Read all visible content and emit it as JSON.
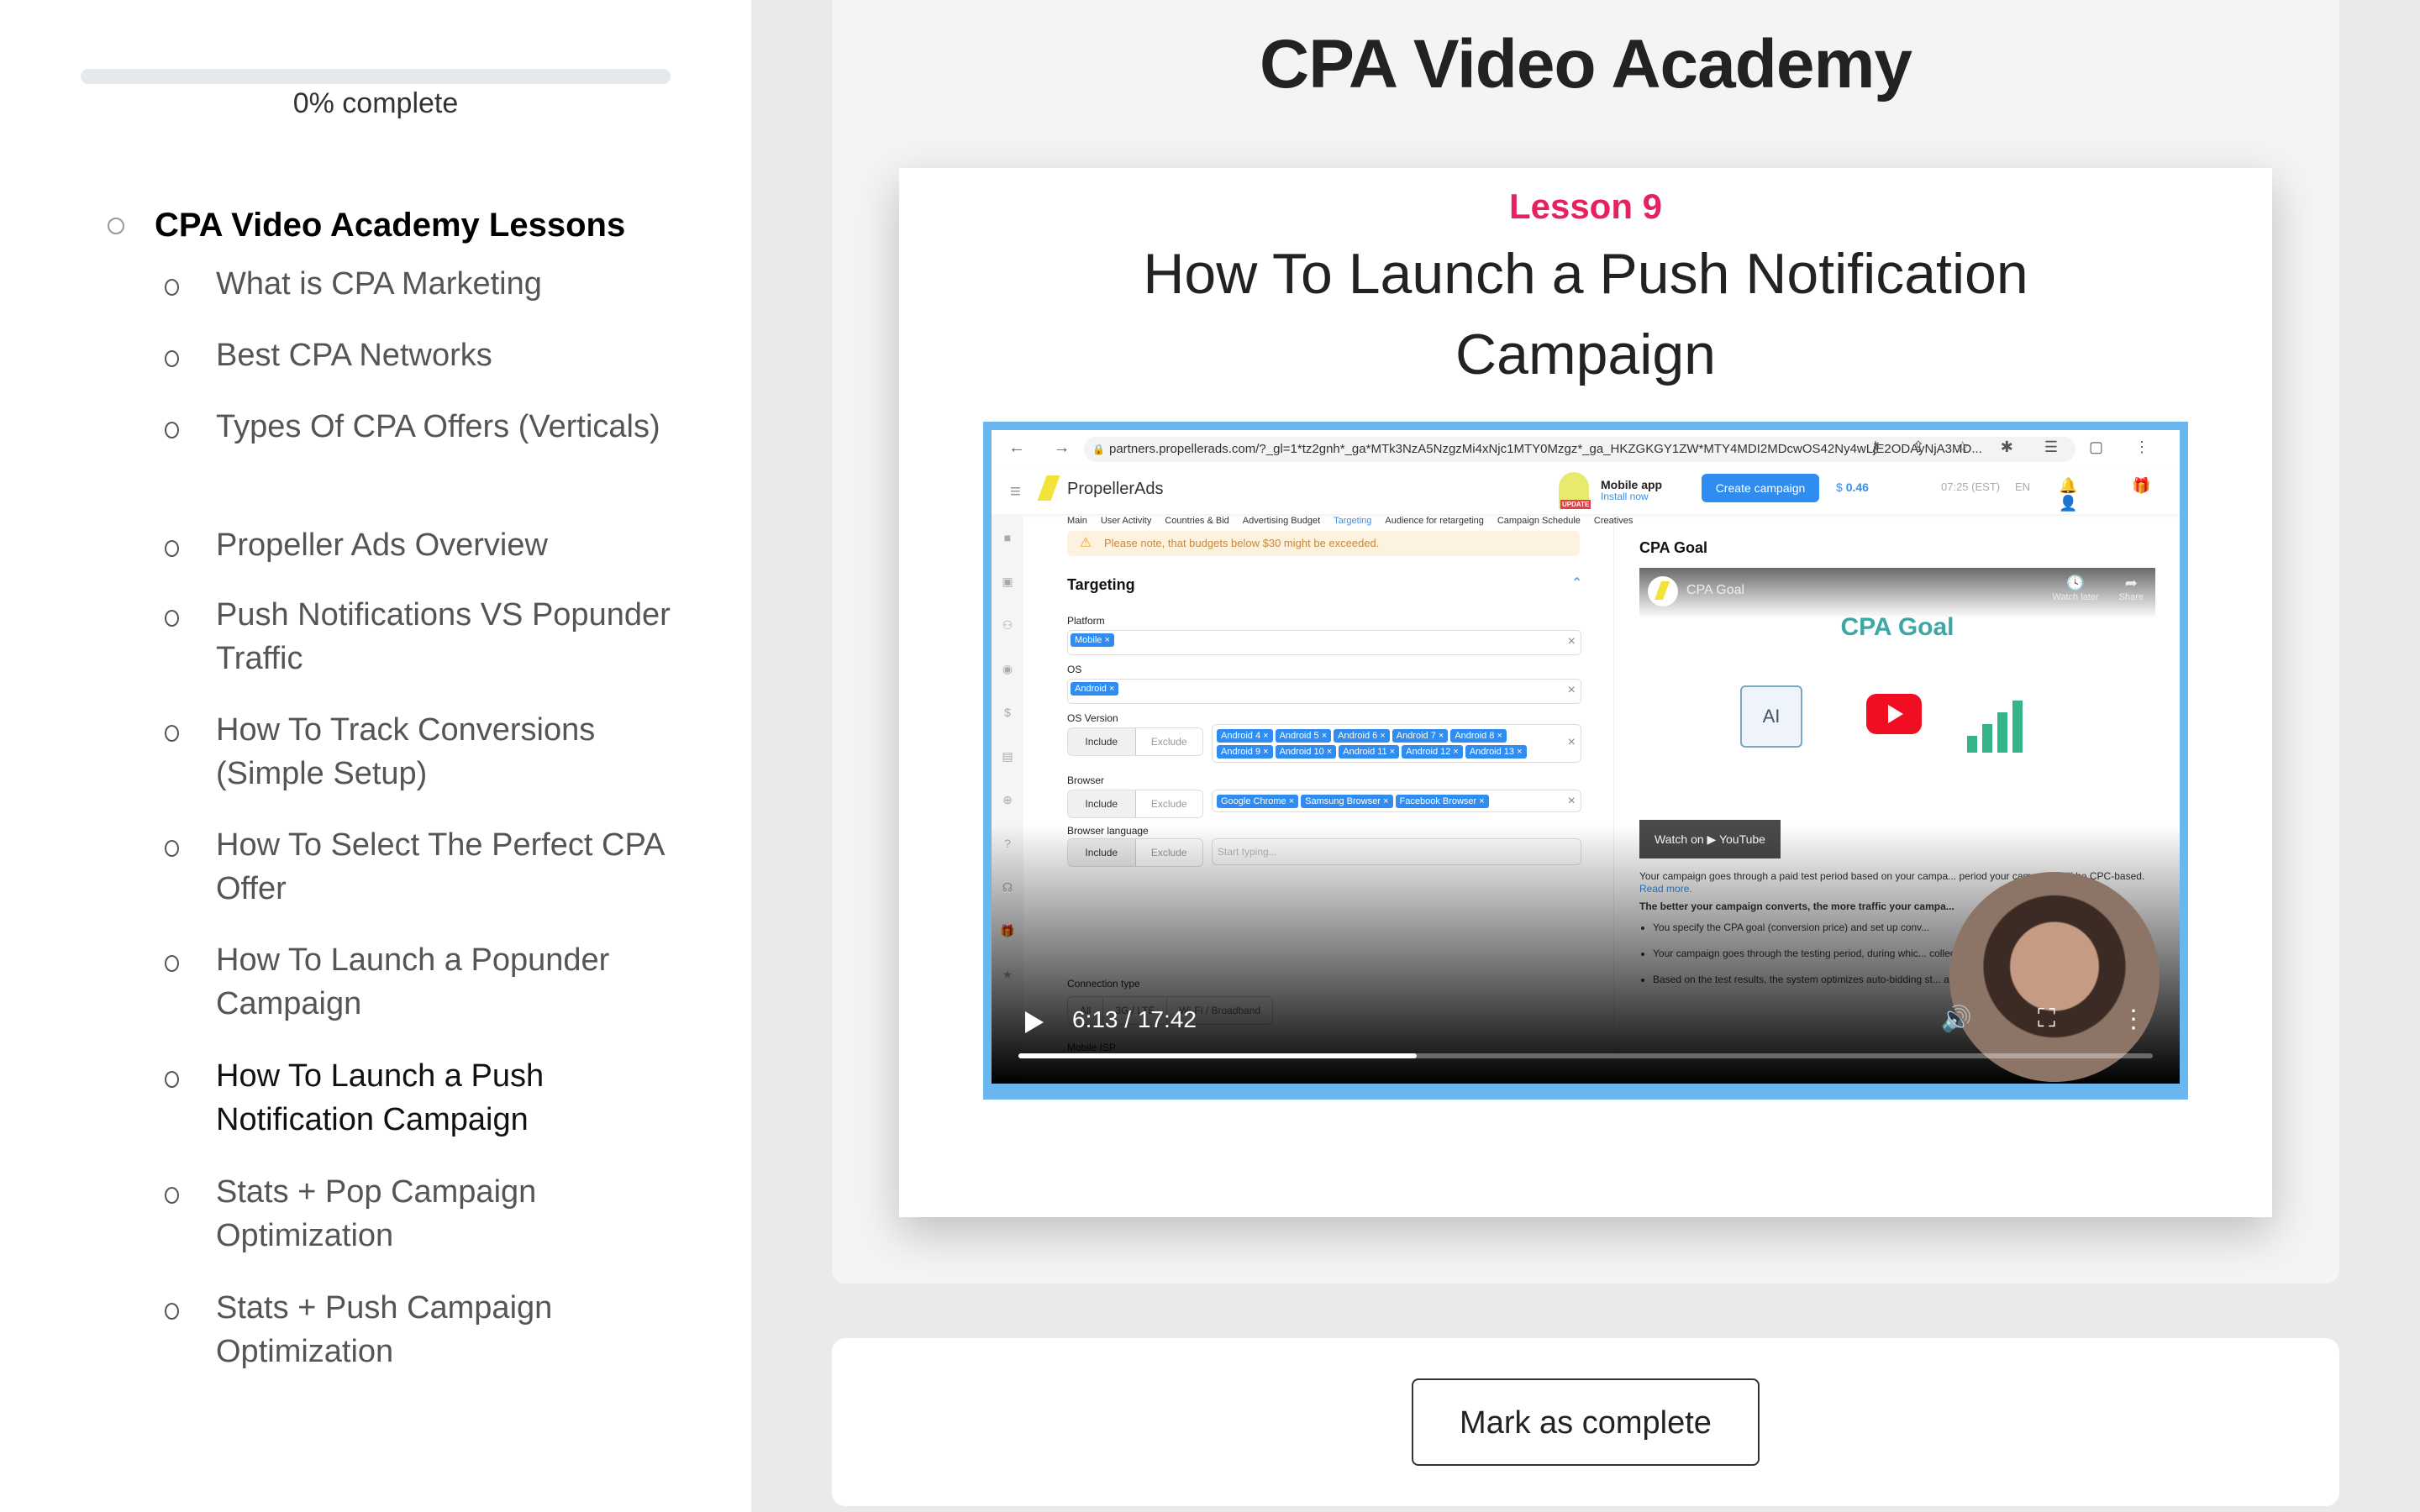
{
  "sidebar": {
    "progress": {
      "percent": 0,
      "label": "0% complete"
    },
    "section_title": "CPA Video Academy Lessons",
    "lessons": [
      {
        "label": "What is CPA Marketing",
        "active": false
      },
      {
        "label": "Best CPA Networks",
        "active": false
      },
      {
        "label": "Types Of CPA Offers (Verticals)",
        "active": false
      },
      {
        "label": "Propeller Ads Overview",
        "active": false
      },
      {
        "label": "Push Notifications VS Popunder Traffic",
        "active": false
      },
      {
        "label": "How To Track Conversions (Simple Setup)",
        "active": false
      },
      {
        "label": "How To Select The Perfect CPA Offer",
        "active": false
      },
      {
        "label": "How To Launch a Popunder Campaign",
        "active": false
      },
      {
        "label": "How To Launch a Push Notification Campaign",
        "active": true
      },
      {
        "label": "Stats + Pop Campaign Optimization",
        "active": false
      },
      {
        "label": "Stats + Push Campaign Optimization",
        "active": false
      }
    ]
  },
  "main": {
    "course_title": "CPA Video Academy",
    "lesson_number": "Lesson 9",
    "lesson_title": "How To Launch a Push Notification Campaign",
    "accent_color": "#e5225f"
  },
  "video": {
    "current_time": "6:13",
    "duration": "17:42",
    "time_label": "6:13 / 17:42",
    "played_fraction": 0.351,
    "frame_color": "#6ab7ef",
    "screen": {
      "browser": {
        "url": "partners.propellerads.com/?_gl=1*tz2gnh*_ga*MTk3NzA5NzgzMi4xNjc1MTY0Mzgz*_ga_HKZGKGY1ZW*MTY4MDI2MDcwOS42Ny4wLjE2ODAyNjA3MD...",
        "nav_icons": "← → C",
        "toolbar_icons": "⚷ ⇪ ☆ ✱ ☰ ▢ ⋮"
      },
      "app": {
        "brand": "PropellerAds",
        "mobile_app_title": "Mobile app",
        "mobile_app_link": "Install now",
        "update_badge": "UPDATE",
        "create_campaign": "Create campaign",
        "balance_symbol": "$",
        "balance_value": "0.46",
        "time": "07:25 (EST)",
        "language": "EN",
        "header_icons": "🔔 🎁 👤",
        "tabs": [
          {
            "label": "Main",
            "active": false
          },
          {
            "label": "User Activity",
            "active": false
          },
          {
            "label": "Countries & Bid",
            "active": false
          },
          {
            "label": "Advertising Budget",
            "active": false
          },
          {
            "label": "Targeting",
            "active": true
          },
          {
            "label": "Audience for retargeting",
            "active": false
          },
          {
            "label": "Campaign Schedule",
            "active": false
          },
          {
            "label": "Creatives",
            "active": false
          }
        ],
        "warning": "Please note, that budgets below $30 might be exceeded.",
        "targeting_title": "Targeting",
        "platform_label": "Platform",
        "platform_chips": [
          "Mobile ×"
        ],
        "os_label": "OS",
        "os_chips": [
          "Android ×"
        ],
        "os_version_label": "OS Version",
        "os_version_chips": [
          "Android 4 ×",
          "Android 5 ×",
          "Android 6 ×",
          "Android 7 ×",
          "Android 8 ×",
          "Android 9 ×",
          "Android 10 ×",
          "Android 11 ×",
          "Android 12 ×",
          "Android 13 ×"
        ],
        "browser_label": "Browser",
        "browser_chips": [
          "Google Chrome ×",
          "Samsung Browser ×",
          "Facebook Browser ×"
        ],
        "browser_language_label": "Browser language",
        "browser_language_placeholder": "Start typing...",
        "include_label": "Include",
        "exclude_label": "Exclude",
        "clear_icon": "×",
        "connection_type_label": "Connection type",
        "connection_options": [
          "All",
          "3G / LTE",
          "Wi-Fi / Broadband"
        ],
        "mobile_isp_label": "Mobile ISP",
        "cpa_goal_heading": "CPA Goal",
        "yt": {
          "channel_title": "CPA Goal",
          "big_title": "CPA Goal",
          "ai_label": "AI",
          "watch_later": "Watch later",
          "share": "Share",
          "watch_on": "Watch on ▶ YouTube"
        },
        "desc_p1": "Your campaign goes through a paid test period based on your campa... period your campaign will be CPC-based.",
        "desc_read_more": "Read more.",
        "desc_p2": "The better your campaign converts, the more traffic your campa...",
        "desc_bullets": [
          "You specify the CPA goal (conversion price) and set up conv...",
          "Your campaign goes through the testing period, during whic... collects and analyzes their CR data.",
          "Based on the test results, the system optimizes auto-bidding st... at the desired price."
        ]
      }
    }
  },
  "actions": {
    "mark_complete": "Mark as complete"
  }
}
